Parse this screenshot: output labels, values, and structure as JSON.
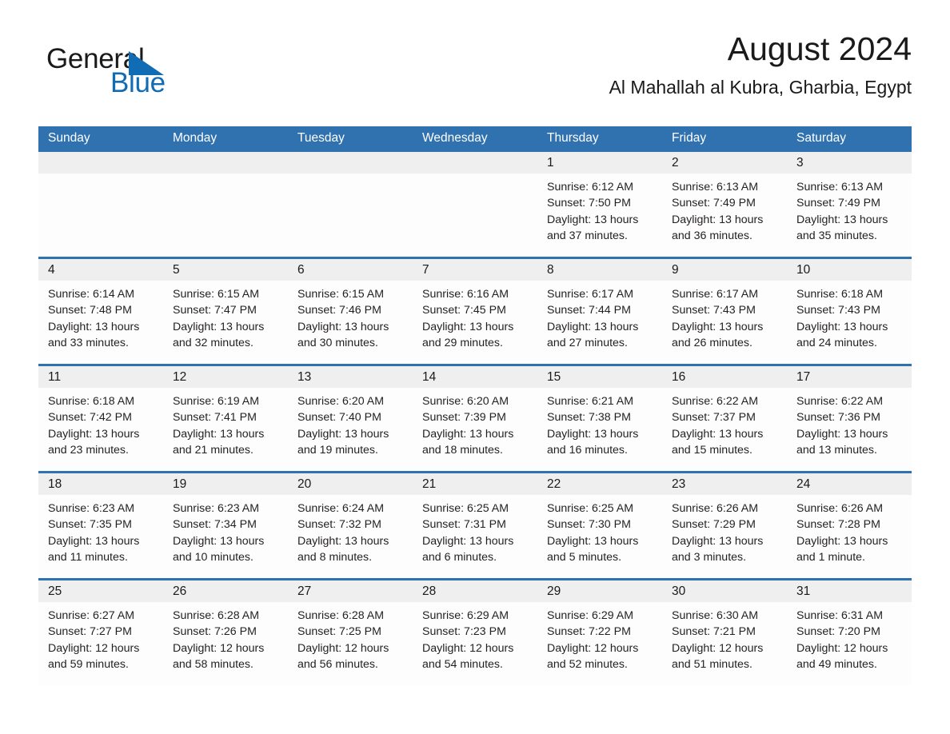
{
  "brand": {
    "name_part1": "General",
    "name_part2": "Blue",
    "triangle_color": "#0f6cb5"
  },
  "header": {
    "title": "August 2024",
    "subtitle": "Al Mahallah al Kubra, Gharbia, Egypt"
  },
  "colors": {
    "header_blue": "#3071b0",
    "daynum_band": "#efefef",
    "text": "#231f20"
  },
  "weekdays": [
    "Sunday",
    "Monday",
    "Tuesday",
    "Wednesday",
    "Thursday",
    "Friday",
    "Saturday"
  ],
  "weeks": [
    [
      {
        "day": "",
        "sunrise": "",
        "sunset": "",
        "daylight1": "",
        "daylight2": ""
      },
      {
        "day": "",
        "sunrise": "",
        "sunset": "",
        "daylight1": "",
        "daylight2": ""
      },
      {
        "day": "",
        "sunrise": "",
        "sunset": "",
        "daylight1": "",
        "daylight2": ""
      },
      {
        "day": "",
        "sunrise": "",
        "sunset": "",
        "daylight1": "",
        "daylight2": ""
      },
      {
        "day": "1",
        "sunrise": "Sunrise: 6:12 AM",
        "sunset": "Sunset: 7:50 PM",
        "daylight1": "Daylight: 13 hours",
        "daylight2": "and 37 minutes."
      },
      {
        "day": "2",
        "sunrise": "Sunrise: 6:13 AM",
        "sunset": "Sunset: 7:49 PM",
        "daylight1": "Daylight: 13 hours",
        "daylight2": "and 36 minutes."
      },
      {
        "day": "3",
        "sunrise": "Sunrise: 6:13 AM",
        "sunset": "Sunset: 7:49 PM",
        "daylight1": "Daylight: 13 hours",
        "daylight2": "and 35 minutes."
      }
    ],
    [
      {
        "day": "4",
        "sunrise": "Sunrise: 6:14 AM",
        "sunset": "Sunset: 7:48 PM",
        "daylight1": "Daylight: 13 hours",
        "daylight2": "and 33 minutes."
      },
      {
        "day": "5",
        "sunrise": "Sunrise: 6:15 AM",
        "sunset": "Sunset: 7:47 PM",
        "daylight1": "Daylight: 13 hours",
        "daylight2": "and 32 minutes."
      },
      {
        "day": "6",
        "sunrise": "Sunrise: 6:15 AM",
        "sunset": "Sunset: 7:46 PM",
        "daylight1": "Daylight: 13 hours",
        "daylight2": "and 30 minutes."
      },
      {
        "day": "7",
        "sunrise": "Sunrise: 6:16 AM",
        "sunset": "Sunset: 7:45 PM",
        "daylight1": "Daylight: 13 hours",
        "daylight2": "and 29 minutes."
      },
      {
        "day": "8",
        "sunrise": "Sunrise: 6:17 AM",
        "sunset": "Sunset: 7:44 PM",
        "daylight1": "Daylight: 13 hours",
        "daylight2": "and 27 minutes."
      },
      {
        "day": "9",
        "sunrise": "Sunrise: 6:17 AM",
        "sunset": "Sunset: 7:43 PM",
        "daylight1": "Daylight: 13 hours",
        "daylight2": "and 26 minutes."
      },
      {
        "day": "10",
        "sunrise": "Sunrise: 6:18 AM",
        "sunset": "Sunset: 7:43 PM",
        "daylight1": "Daylight: 13 hours",
        "daylight2": "and 24 minutes."
      }
    ],
    [
      {
        "day": "11",
        "sunrise": "Sunrise: 6:18 AM",
        "sunset": "Sunset: 7:42 PM",
        "daylight1": "Daylight: 13 hours",
        "daylight2": "and 23 minutes."
      },
      {
        "day": "12",
        "sunrise": "Sunrise: 6:19 AM",
        "sunset": "Sunset: 7:41 PM",
        "daylight1": "Daylight: 13 hours",
        "daylight2": "and 21 minutes."
      },
      {
        "day": "13",
        "sunrise": "Sunrise: 6:20 AM",
        "sunset": "Sunset: 7:40 PM",
        "daylight1": "Daylight: 13 hours",
        "daylight2": "and 19 minutes."
      },
      {
        "day": "14",
        "sunrise": "Sunrise: 6:20 AM",
        "sunset": "Sunset: 7:39 PM",
        "daylight1": "Daylight: 13 hours",
        "daylight2": "and 18 minutes."
      },
      {
        "day": "15",
        "sunrise": "Sunrise: 6:21 AM",
        "sunset": "Sunset: 7:38 PM",
        "daylight1": "Daylight: 13 hours",
        "daylight2": "and 16 minutes."
      },
      {
        "day": "16",
        "sunrise": "Sunrise: 6:22 AM",
        "sunset": "Sunset: 7:37 PM",
        "daylight1": "Daylight: 13 hours",
        "daylight2": "and 15 minutes."
      },
      {
        "day": "17",
        "sunrise": "Sunrise: 6:22 AM",
        "sunset": "Sunset: 7:36 PM",
        "daylight1": "Daylight: 13 hours",
        "daylight2": "and 13 minutes."
      }
    ],
    [
      {
        "day": "18",
        "sunrise": "Sunrise: 6:23 AM",
        "sunset": "Sunset: 7:35 PM",
        "daylight1": "Daylight: 13 hours",
        "daylight2": "and 11 minutes."
      },
      {
        "day": "19",
        "sunrise": "Sunrise: 6:23 AM",
        "sunset": "Sunset: 7:34 PM",
        "daylight1": "Daylight: 13 hours",
        "daylight2": "and 10 minutes."
      },
      {
        "day": "20",
        "sunrise": "Sunrise: 6:24 AM",
        "sunset": "Sunset: 7:32 PM",
        "daylight1": "Daylight: 13 hours",
        "daylight2": "and 8 minutes."
      },
      {
        "day": "21",
        "sunrise": "Sunrise: 6:25 AM",
        "sunset": "Sunset: 7:31 PM",
        "daylight1": "Daylight: 13 hours",
        "daylight2": "and 6 minutes."
      },
      {
        "day": "22",
        "sunrise": "Sunrise: 6:25 AM",
        "sunset": "Sunset: 7:30 PM",
        "daylight1": "Daylight: 13 hours",
        "daylight2": "and 5 minutes."
      },
      {
        "day": "23",
        "sunrise": "Sunrise: 6:26 AM",
        "sunset": "Sunset: 7:29 PM",
        "daylight1": "Daylight: 13 hours",
        "daylight2": "and 3 minutes."
      },
      {
        "day": "24",
        "sunrise": "Sunrise: 6:26 AM",
        "sunset": "Sunset: 7:28 PM",
        "daylight1": "Daylight: 13 hours",
        "daylight2": "and 1 minute."
      }
    ],
    [
      {
        "day": "25",
        "sunrise": "Sunrise: 6:27 AM",
        "sunset": "Sunset: 7:27 PM",
        "daylight1": "Daylight: 12 hours",
        "daylight2": "and 59 minutes."
      },
      {
        "day": "26",
        "sunrise": "Sunrise: 6:28 AM",
        "sunset": "Sunset: 7:26 PM",
        "daylight1": "Daylight: 12 hours",
        "daylight2": "and 58 minutes."
      },
      {
        "day": "27",
        "sunrise": "Sunrise: 6:28 AM",
        "sunset": "Sunset: 7:25 PM",
        "daylight1": "Daylight: 12 hours",
        "daylight2": "and 56 minutes."
      },
      {
        "day": "28",
        "sunrise": "Sunrise: 6:29 AM",
        "sunset": "Sunset: 7:23 PM",
        "daylight1": "Daylight: 12 hours",
        "daylight2": "and 54 minutes."
      },
      {
        "day": "29",
        "sunrise": "Sunrise: 6:29 AM",
        "sunset": "Sunset: 7:22 PM",
        "daylight1": "Daylight: 12 hours",
        "daylight2": "and 52 minutes."
      },
      {
        "day": "30",
        "sunrise": "Sunrise: 6:30 AM",
        "sunset": "Sunset: 7:21 PM",
        "daylight1": "Daylight: 12 hours",
        "daylight2": "and 51 minutes."
      },
      {
        "day": "31",
        "sunrise": "Sunrise: 6:31 AM",
        "sunset": "Sunset: 7:20 PM",
        "daylight1": "Daylight: 12 hours",
        "daylight2": "and 49 minutes."
      }
    ]
  ]
}
